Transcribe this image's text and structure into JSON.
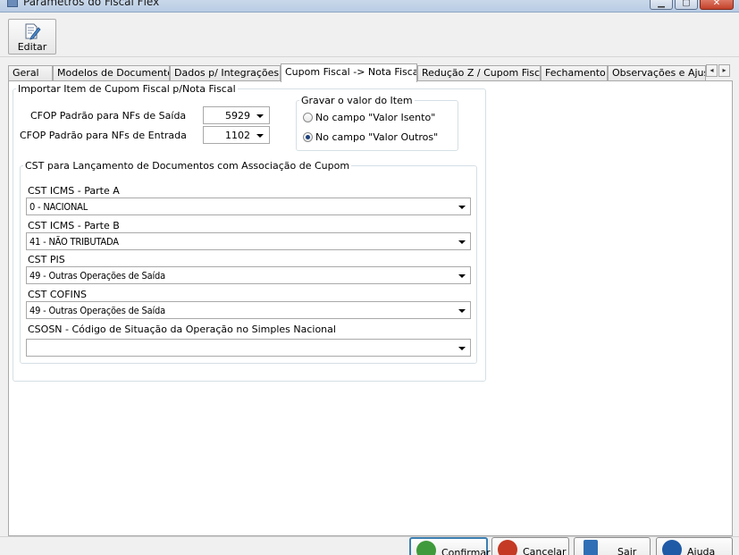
{
  "window": {
    "title": "Parâmetros do Fiscal Flex"
  },
  "toolbar": {
    "editar_label": "Editar"
  },
  "tabs": [
    {
      "label": "Geral"
    },
    {
      "label": "Modelos de Documento"
    },
    {
      "label": "Dados p/ Integrações"
    },
    {
      "label": "Cupom Fiscal -> Nota Fiscal"
    },
    {
      "label": "Redução Z / Cupom Fiscal"
    },
    {
      "label": "Fechamento"
    },
    {
      "label": "Observações e Ajus"
    }
  ],
  "import_group": {
    "legend": "Importar Item de Cupom Fiscal p/Nota Fiscal",
    "cfop_saida_label": "CFOP Padrão para NFs de Saída",
    "cfop_saida_value": "5929",
    "cfop_entrada_label": "CFOP Padrão para NFs de Entrada",
    "cfop_entrada_value": "1102"
  },
  "gravar_group": {
    "legend": "Gravar o valor do Item",
    "option_isento": "No campo \"Valor Isento\"",
    "option_outros": "No campo \"Valor Outros\"",
    "selected": "option_outros"
  },
  "cst_group": {
    "legend": "CST para Lançamento de Documentos com Associação de Cupom",
    "icms_a_label": "CST ICMS - Parte A",
    "icms_a_value": "0 - NACIONAL",
    "icms_b_label": "CST ICMS - Parte B",
    "icms_b_value": "41 - NÃO TRIBUTADA",
    "pis_label": "CST PIS",
    "pis_value": "49 - Outras Operações de Saída",
    "cofins_label": "CST COFINS",
    "cofins_value": "49 - Outras Operações de Saída",
    "csosn_label": "CSOSN - Código de Situação da Operação no Simples Nacional",
    "csosn_value": ""
  },
  "buttons": {
    "confirmar": "Confirmar",
    "cancelar": "Cancelar",
    "sair": "Sair",
    "ajuda": "Ajuda"
  },
  "colors": {
    "confirm_icon": "#3f9a3b",
    "cancel_icon": "#c43a24",
    "sair_icon": "#2f6fb5",
    "help_icon": "#1f5aa6"
  }
}
